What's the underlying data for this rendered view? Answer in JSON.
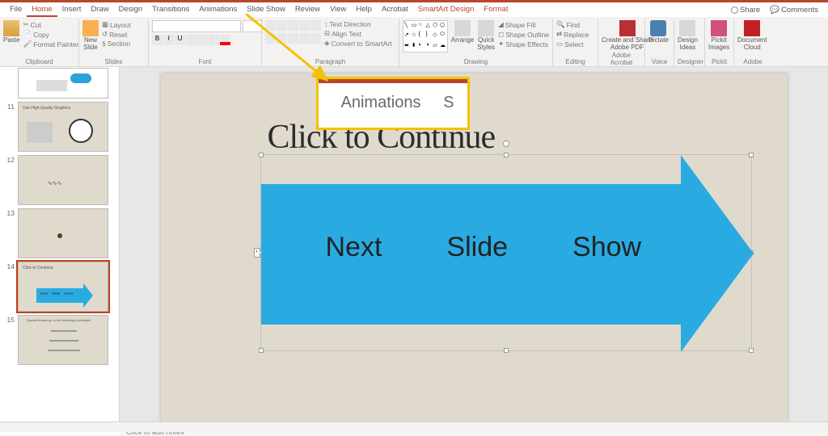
{
  "menu": {
    "file": "File",
    "home": "Home",
    "insert": "Insert",
    "draw": "Draw",
    "design": "Design",
    "transitions": "Transitions",
    "animations": "Animations",
    "slideshow": "Slide Show",
    "review": "Review",
    "view": "View",
    "help": "Help",
    "acrobat": "Acrobat",
    "smartart": "SmartArt Design",
    "format": "Format",
    "share": "Share",
    "comments": "Comments"
  },
  "ribbon": {
    "clipboard": {
      "label": "Clipboard",
      "paste": "Paste",
      "cut": "Cut",
      "copy": "Copy",
      "painter": "Format Painter"
    },
    "slides": {
      "label": "Slides",
      "new": "New\nSlide",
      "layout": "Layout",
      "reset": "Reset",
      "section": "Section"
    },
    "font": {
      "label": "Font"
    },
    "paragraph": {
      "label": "Paragraph",
      "textdir": "Text Direction",
      "align": "Align Text",
      "smartart": "Convert to SmartArt"
    },
    "drawing": {
      "label": "Drawing",
      "arrange": "Arrange",
      "quick": "Quick\nStyles",
      "fill": "Shape Fill",
      "outline": "Shape Outline",
      "effects": "Shape Effects"
    },
    "editing": {
      "label": "Editing",
      "find": "Find",
      "replace": "Replace",
      "select": "Select"
    },
    "adobe": {
      "label": "Adobe Acrobat",
      "create": "Create and Share\nAdobe PDF"
    },
    "voice": {
      "label": "Voice",
      "dictate": "Dictate"
    },
    "designer": {
      "label": "Designer",
      "ideas": "Design\nIdeas"
    },
    "pickit": {
      "label": "Pickit",
      "images": "Pickit\nImages"
    },
    "cloud": {
      "label": "Adobe",
      "doc": "Document\nCloud"
    }
  },
  "thumbs": {
    "t11": {
      "num": "11",
      "title": "Use High-Quality Graphics"
    },
    "t12": {
      "num": "12"
    },
    "t13": {
      "num": "13"
    },
    "t14": {
      "num": "14",
      "title": "Click to Continue",
      "a": "Next",
      "b": "Slide",
      "c": "Show"
    },
    "t15": {
      "num": "15",
      "line1": "Special thanks go to the following individuals"
    }
  },
  "slide": {
    "title": "Click to Continue",
    "w1": "Next",
    "w2": "Slide",
    "w3": "Show"
  },
  "callout": {
    "text": "Animations",
    "partial": "S"
  },
  "notes": "Click to add notes"
}
